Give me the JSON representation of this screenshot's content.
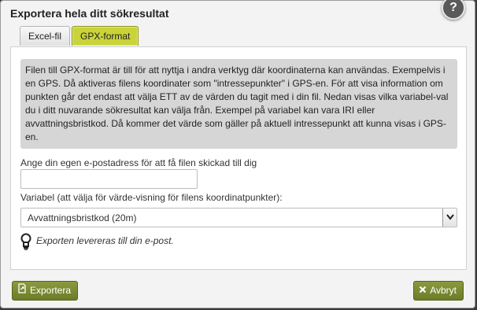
{
  "dialog": {
    "title": "Exportera hela ditt sökresultat",
    "help_label": "?"
  },
  "tabs": [
    {
      "label": "Excel-fil",
      "active": false
    },
    {
      "label": "GPX-format",
      "active": true
    }
  ],
  "info_text": "Filen till GPX-format är till för att nyttja i andra verktyg där koordinaterna kan användas. Exempelvis i en GPS. Då aktiveras filens koordinater som \"intressepunkter\" i GPS-en. För att visa information om punkten går det endast att välja ETT av de värden du tagit med i din fil. Nedan visas vilka variabel-val du i ditt nuvarande sökresultat kan välja från. Exempel på variabel kan vara IRI eller avvattningsbristkod. Då kommer det värde som gäller på aktuell intressepunkt att kunna visas i GPS-en.",
  "email": {
    "label": "Ange din egen e-postadress för att få filen skickad till dig",
    "value": ""
  },
  "variable": {
    "label": "Variabel (att välja för värde-visning för filens koordinatpunkter):",
    "selected": "Avvattningsbristkod (20m)"
  },
  "note": "Exporten levereras till din e-post.",
  "buttons": {
    "export_label": "Exportera",
    "cancel_label": "Avbryt"
  },
  "colors": {
    "active_tab": "#c9d33a",
    "button": "#6b7c28",
    "info_bg": "#d6d6d6"
  },
  "icons": [
    "help-icon",
    "lightbulb-icon",
    "export-icon",
    "close-icon",
    "chevron-down-icon"
  ]
}
